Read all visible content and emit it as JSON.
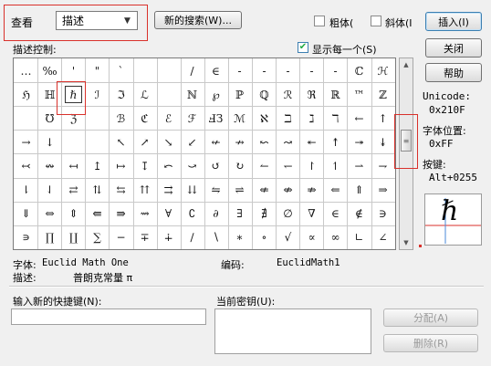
{
  "view": {
    "label": "查看",
    "dropdown_value": "描述",
    "dropdown_arrow_icon": "chevron-down-icon"
  },
  "toolbar": {
    "new_search_button": "新的搜索(W)...",
    "bold_label": "粗体(",
    "italic_label": "斜体(I",
    "insert_button": "插入(I)",
    "close_button": "关闭",
    "help_button": "帮助"
  },
  "description_control": {
    "label": "描述控制:",
    "show_each_label": "显示每一个(S)",
    "show_each_checked": true
  },
  "symbol_grid": {
    "rows": [
      [
        "…",
        "‰",
        "'",
        "\"",
        "`",
        "",
        "",
        "/",
        "∈",
        "-",
        "-",
        "-",
        "-",
        "-",
        "ℂ",
        "ℋ"
      ],
      [
        "ℌ",
        "ℍ",
        "ℏ",
        "ℐ",
        "ℑ",
        "ℒ",
        "",
        "ℕ",
        "℘",
        "ℙ",
        "ℚ",
        "ℛ",
        "ℜ",
        "ℝ",
        "™",
        "ℤ"
      ],
      [
        "",
        "℧",
        "ℨ",
        "",
        "ℬ",
        "ℭ",
        "ℰ",
        "ℱ",
        "ℲЗ",
        "ℳ",
        "ℵ",
        "ℶ",
        "ℷ",
        "ℸ",
        "←",
        "↑"
      ],
      [
        "→",
        "↓",
        "",
        "",
        "↖",
        "↗",
        "↘",
        "↙",
        "↚",
        "↛",
        "↜",
        "↝",
        "↞",
        "↟",
        "↠",
        "↡"
      ],
      [
        "↢",
        "↭",
        "↤",
        "↥",
        "↦",
        "↧",
        "⤺",
        "⤻",
        "↺",
        "↻",
        "↼",
        "↽",
        "↾",
        "↿",
        "⇀",
        "⇁"
      ],
      [
        "⇂",
        "⇃",
        "⇄",
        "⇅",
        "⇆",
        "⇈",
        "⇉",
        "⇊",
        "⇋",
        "⇌",
        "⇍",
        "⇎",
        "⇏",
        "⇐",
        "⇑",
        "⇒"
      ],
      [
        "⇓",
        "⇔",
        "⇕",
        "⇚",
        "⇛",
        "⇝",
        "∀",
        "∁",
        "∂",
        "∃",
        "∄",
        "∅",
        "∇",
        "∈",
        "∉",
        "∋"
      ],
      [
        "∍",
        "∏",
        "∐",
        "∑",
        "−",
        "∓",
        "∔",
        "∕",
        "∖",
        "∗",
        "∘",
        "√",
        "∝",
        "∞",
        "∟",
        "∠"
      ]
    ],
    "selected_symbol": "ℏ"
  },
  "unicode_info": {
    "unicode_label": "Unicode:",
    "unicode_value": "0x210F",
    "font_position_label": "字体位置:",
    "font_position_value": "0xFF",
    "key_label": "按键:",
    "key_value": "Alt+0255",
    "preview_symbol": "ℏ"
  },
  "font_info": {
    "font_label": "字体:",
    "font_value": "Euclid Math One",
    "code_label": "编码:",
    "code_value": "EuclidMath1",
    "desc_label": "描述:",
    "desc_value": "普朗克常量 π"
  },
  "shortcut": {
    "new_shortcut_label": "输入新的快捷键(N):",
    "new_shortcut_value": "",
    "current_key_label": "当前密钥(U):",
    "current_key_value": "",
    "assign_button": "分配(A)",
    "delete_button": "删除(R)"
  },
  "colors": {
    "highlight": "#d9312b"
  }
}
